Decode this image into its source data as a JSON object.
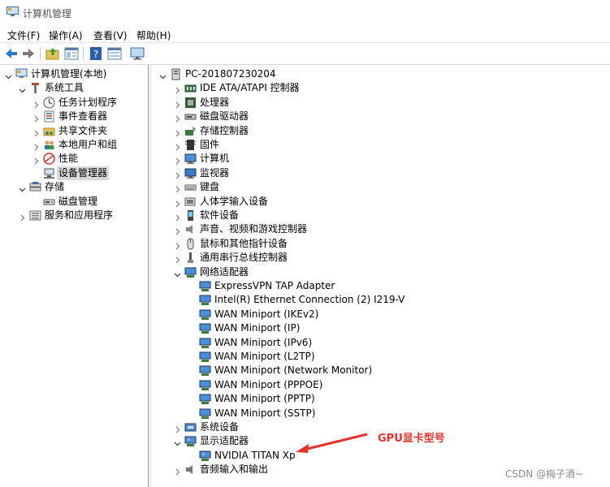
{
  "window": {
    "title": "计算机管理"
  },
  "menu": [
    "文件(F)",
    "操作(A)",
    "查看(V)",
    "帮助(H)"
  ],
  "toolbar": [
    "back-icon",
    "forward-icon",
    "up-folder-icon",
    "show-hide-tree-icon",
    "help-icon",
    "properties-icon",
    "monitor-icon"
  ],
  "left_tree": [
    {
      "label": "计算机管理(本地)",
      "level": 0,
      "icon": "computer-management-icon",
      "expand": "open"
    },
    {
      "label": "系统工具",
      "level": 1,
      "icon": "tools-icon",
      "expand": "open"
    },
    {
      "label": "任务计划程序",
      "level": 2,
      "icon": "clock-icon",
      "expand": "closed"
    },
    {
      "label": "事件查看器",
      "level": 2,
      "icon": "event-viewer-icon",
      "expand": "closed"
    },
    {
      "label": "共享文件夹",
      "level": 2,
      "icon": "shared-folder-icon",
      "expand": "closed"
    },
    {
      "label": "本地用户和组",
      "level": 2,
      "icon": "users-icon",
      "expand": "closed"
    },
    {
      "label": "性能",
      "level": 2,
      "icon": "performance-icon",
      "expand": "closed"
    },
    {
      "label": "设备管理器",
      "level": 2,
      "icon": "device-manager-icon",
      "expand": "none",
      "selected": true
    },
    {
      "label": "存储",
      "level": 1,
      "icon": "storage-icon",
      "expand": "open"
    },
    {
      "label": "磁盘管理",
      "level": 2,
      "icon": "disk-management-icon",
      "expand": "none"
    },
    {
      "label": "服务和应用程序",
      "level": 1,
      "icon": "services-icon",
      "expand": "closed"
    }
  ],
  "device_tree": [
    {
      "label": "PC-201807230204",
      "level": 0,
      "icon": "computer-root-icon",
      "expand": "open"
    },
    {
      "label": "IDE ATA/ATAPI 控制器",
      "level": 1,
      "icon": "ide-controller-icon",
      "expand": "closed"
    },
    {
      "label": "处理器",
      "level": 1,
      "icon": "processor-icon",
      "expand": "closed"
    },
    {
      "label": "磁盘驱动器",
      "level": 1,
      "icon": "disk-drive-icon",
      "expand": "closed"
    },
    {
      "label": "存储控制器",
      "level": 1,
      "icon": "storage-controller-icon",
      "expand": "closed"
    },
    {
      "label": "固件",
      "level": 1,
      "icon": "firmware-icon",
      "expand": "closed"
    },
    {
      "label": "计算机",
      "level": 1,
      "icon": "computer-icon",
      "expand": "closed"
    },
    {
      "label": "监视器",
      "level": 1,
      "icon": "monitor-icon",
      "expand": "closed"
    },
    {
      "label": "键盘",
      "level": 1,
      "icon": "keyboard-icon",
      "expand": "closed"
    },
    {
      "label": "人体学输入设备",
      "level": 1,
      "icon": "hid-icon",
      "expand": "closed"
    },
    {
      "label": "软件设备",
      "level": 1,
      "icon": "software-device-icon",
      "expand": "closed"
    },
    {
      "label": "声音、视频和游戏控制器",
      "level": 1,
      "icon": "speaker-icon",
      "expand": "closed"
    },
    {
      "label": "鼠标和其他指针设备",
      "level": 1,
      "icon": "mouse-icon",
      "expand": "closed"
    },
    {
      "label": "通用串行总线控制器",
      "level": 1,
      "icon": "usb-icon",
      "expand": "closed"
    },
    {
      "label": "网络适配器",
      "level": 1,
      "icon": "network-adapter-icon",
      "expand": "open"
    },
    {
      "label": "ExpressVPN TAP Adapter",
      "level": 2,
      "icon": "network-adapter-icon",
      "expand": "none"
    },
    {
      "label": "Intel(R) Ethernet Connection (2) I219-V",
      "level": 2,
      "icon": "network-adapter-icon",
      "expand": "none"
    },
    {
      "label": "WAN Miniport (IKEv2)",
      "level": 2,
      "icon": "network-adapter-icon",
      "expand": "none"
    },
    {
      "label": "WAN Miniport (IP)",
      "level": 2,
      "icon": "network-adapter-icon",
      "expand": "none"
    },
    {
      "label": "WAN Miniport (IPv6)",
      "level": 2,
      "icon": "network-adapter-icon",
      "expand": "none"
    },
    {
      "label": "WAN Miniport (L2TP)",
      "level": 2,
      "icon": "network-adapter-icon",
      "expand": "none"
    },
    {
      "label": "WAN Miniport (Network Monitor)",
      "level": 2,
      "icon": "network-adapter-icon",
      "expand": "none"
    },
    {
      "label": "WAN Miniport (PPPOE)",
      "level": 2,
      "icon": "network-adapter-icon",
      "expand": "none"
    },
    {
      "label": "WAN Miniport (PPTP)",
      "level": 2,
      "icon": "network-adapter-icon",
      "expand": "none"
    },
    {
      "label": "WAN Miniport (SSTP)",
      "level": 2,
      "icon": "network-adapter-icon",
      "expand": "none"
    },
    {
      "label": "系统设备",
      "level": 1,
      "icon": "system-devices-icon",
      "expand": "closed"
    },
    {
      "label": "显示适配器",
      "level": 1,
      "icon": "display-adapter-icon",
      "expand": "open"
    },
    {
      "label": "NVIDIA TITAN Xp",
      "level": 2,
      "icon": "display-adapter-icon",
      "expand": "none"
    },
    {
      "label": "音频输入和输出",
      "level": 1,
      "icon": "audio-icon",
      "expand": "closed"
    }
  ],
  "annotation": {
    "text": "GPU显卡型号",
    "color": "#e8302a"
  },
  "watermark": "CSDN @梅子酒~"
}
